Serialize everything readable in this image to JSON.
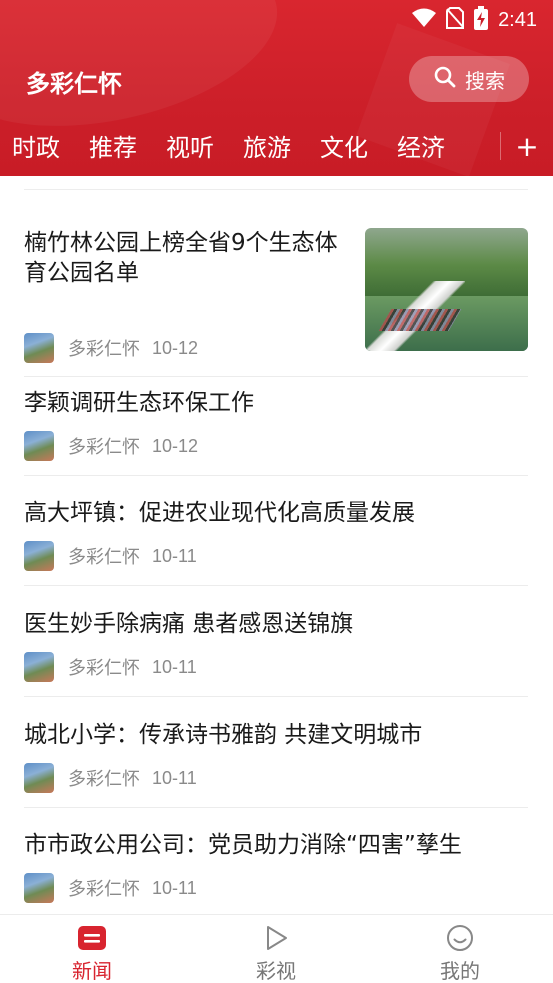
{
  "status_bar": {
    "time": "2:41"
  },
  "app": {
    "title": "多彩仁怀"
  },
  "search": {
    "label": "搜索"
  },
  "tabs": [
    {
      "label": "时政"
    },
    {
      "label": "推荐"
    },
    {
      "label": "视听"
    },
    {
      "label": "旅游"
    },
    {
      "label": "文化"
    },
    {
      "label": "经济"
    }
  ],
  "tabs_more": "+",
  "news": [
    {
      "title": "楠竹林公园上榜全省9个生态体育公园名单",
      "source": "多彩仁怀",
      "date": "10-12",
      "has_thumb": true
    },
    {
      "title": "李颖调研生态环保工作",
      "source": "多彩仁怀",
      "date": "10-12"
    },
    {
      "title": "高大坪镇：促进农业现代化高质量发展",
      "source": "多彩仁怀",
      "date": "10-11"
    },
    {
      "title": "医生妙手除病痛 患者感恩送锦旗",
      "source": "多彩仁怀",
      "date": "10-11"
    },
    {
      "title": "城北小学：传承诗书雅韵 共建文明城市",
      "source": "多彩仁怀",
      "date": "10-11"
    },
    {
      "title": "市市政公用公司：党员助力消除“四害”孳生",
      "source": "多彩仁怀",
      "date": "10-11"
    }
  ],
  "bottom_nav": [
    {
      "label": "新闻",
      "icon": "news-icon",
      "active": true
    },
    {
      "label": "彩视",
      "icon": "play-icon",
      "active": false
    },
    {
      "label": "我的",
      "icon": "smiley-icon",
      "active": false
    }
  ],
  "colors": {
    "brand_red": "#d8242f",
    "text_gray": "#8a8a8a"
  }
}
